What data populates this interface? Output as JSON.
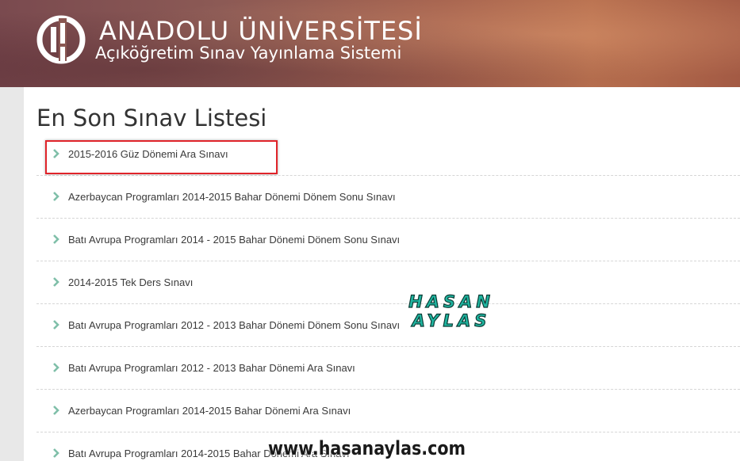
{
  "header": {
    "title": "ANADOLU ÜNİVERSİTESİ",
    "subtitle": "Açıköğretim Sınav Yayınlama Sistemi"
  },
  "page": {
    "title": "En Son Sınav Listesi"
  },
  "exams": [
    "2015-2016 Güz Dönemi Ara Sınavı",
    "Azerbaycan Programları 2014-2015 Bahar Dönemi Dönem Sonu Sınavı",
    "Batı Avrupa Programları 2014 - 2015 Bahar Dönemi Dönem Sonu Sınavı",
    "2014-2015 Tek Ders Sınavı",
    "Batı Avrupa Programları 2012 - 2013 Bahar Dönemi Dönem Sonu Sınavı",
    "Batı Avrupa Programları 2012 - 2013 Bahar Dönemi Ara Sınavı",
    "Azerbaycan Programları 2014-2015 Bahar Dönemi Ara Sınavı",
    "Batı Avrupa Programları 2014-2015 Bahar Dönemi Ara Sınavı"
  ],
  "watermark": {
    "line1": "HASAN",
    "line2": "AYLAS",
    "url": "www.hasanaylas.com"
  },
  "colors": {
    "chevron": "#7fbfa9",
    "highlight": "#e0242a",
    "watermark_fill": "#1fb5a0"
  },
  "icons": {
    "logo": "anadolu-university-logo",
    "list_bullet": "chevron-right-icon"
  }
}
